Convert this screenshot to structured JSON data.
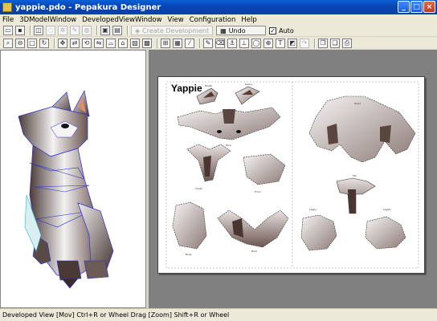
{
  "window": {
    "title": "yappie.pdo - Pepakura Designer",
    "minimize": "_",
    "maximize": "□",
    "close": "×"
  },
  "menu": [
    "File",
    "3DModelWindow",
    "DevelopedViewWindow",
    "View",
    "Configuration",
    "Help"
  ],
  "toolbar": {
    "create_development_label": "Create Development",
    "undo_label": "Undo",
    "auto_label": "Auto",
    "auto_checked": "✓"
  },
  "sheet": {
    "title": "Yappie",
    "part_labels": [
      "Ear(R)",
      "Ear(L)",
      "Face",
      "Chest",
      "Body",
      "Head",
      "Tail",
      "Leg(L)",
      "Leg(R)",
      "Front",
      "Back"
    ]
  },
  "status": {
    "text": "Developed View [Mov] Ctrl+R or Wheel Drag [Zoom] Shift+R or Wheel"
  },
  "colors": {
    "title_bar": "#0a47b6",
    "workspace": "#808080",
    "model_edge": "#2a2ad6",
    "model_fill": "#6b5a55"
  }
}
